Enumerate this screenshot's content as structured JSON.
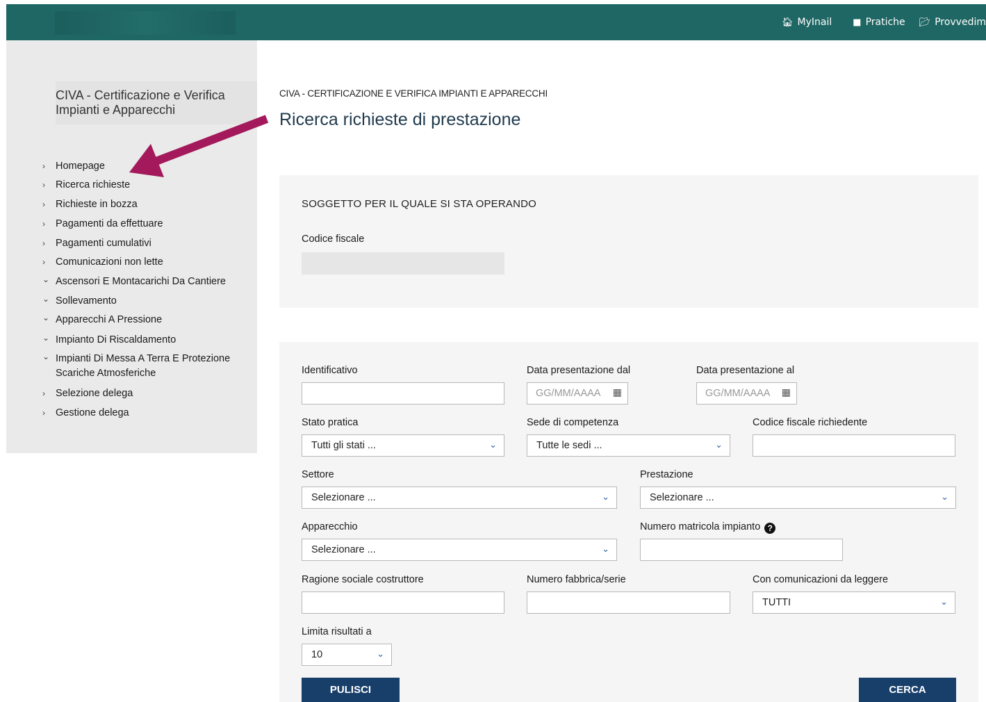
{
  "topbar": {
    "nav": [
      {
        "label": "MyInail",
        "icon": "home-icon"
      },
      {
        "label": "Pratiche",
        "icon": "document-icon"
      },
      {
        "label": "Provvedim",
        "icon": "folder-open-icon"
      }
    ]
  },
  "sidebar": {
    "title": "CIVA - Certificazione e Verifica Impianti e Apparecchi",
    "items": [
      {
        "label": "Homepage",
        "expanded": false
      },
      {
        "label": "Ricerca richieste",
        "expanded": false
      },
      {
        "label": "Richieste in bozza",
        "expanded": false
      },
      {
        "label": "Pagamenti da effettuare",
        "expanded": false
      },
      {
        "label": "Pagamenti cumulativi",
        "expanded": false
      },
      {
        "label": "Comunicazioni non lette",
        "expanded": false
      },
      {
        "label": "Ascensori E Montacarichi Da Cantiere",
        "expanded": true
      },
      {
        "label": "Sollevamento",
        "expanded": true
      },
      {
        "label": "Apparecchi A Pressione",
        "expanded": true
      },
      {
        "label": "Impianto Di Riscaldamento",
        "expanded": true
      },
      {
        "label": "Impianti Di Messa A Terra E Protezione Scariche Atmosferiche",
        "expanded": true
      },
      {
        "label": "Selezione delega",
        "expanded": false
      },
      {
        "label": "Gestione delega",
        "expanded": false
      }
    ]
  },
  "main": {
    "breadcrumb": "CIVA - CERTIFICAZIONE E VERIFICA IMPIANTI E APPARECCHI",
    "title": "Ricerca richieste di prestazione"
  },
  "soggetto": {
    "heading": "SOGGETTO PER IL QUALE SI STA OPERANDO",
    "codice_fiscale_label": "Codice fiscale",
    "codice_fiscale_value": ""
  },
  "form": {
    "identificativo": {
      "label": "Identificativo",
      "value": ""
    },
    "data_dal": {
      "label": "Data presentazione dal",
      "placeholder": "GG/MM/AAAA"
    },
    "data_al": {
      "label": "Data presentazione al",
      "placeholder": "GG/MM/AAAA"
    },
    "stato_pratica": {
      "label": "Stato pratica",
      "value": "Tutti gli stati ..."
    },
    "sede": {
      "label": "Sede di competenza",
      "value": "Tutte le sedi ..."
    },
    "cf_richiedente": {
      "label": "Codice fiscale richiedente",
      "value": ""
    },
    "settore": {
      "label": "Settore",
      "value": "Selezionare ..."
    },
    "prestazione": {
      "label": "Prestazione",
      "value": "Selezionare ..."
    },
    "apparecchio": {
      "label": "Apparecchio",
      "value": "Selezionare ..."
    },
    "matricola": {
      "label": "Numero matricola impianto",
      "value": ""
    },
    "ragione_sociale": {
      "label": "Ragione sociale costruttore",
      "value": ""
    },
    "numero_fabbrica": {
      "label": "Numero fabbrica/serie",
      "value": ""
    },
    "comunicazioni": {
      "label": "Con comunicazioni da leggere",
      "value": "TUTTI"
    },
    "limita": {
      "label": "Limita risultati a",
      "value": "10"
    }
  },
  "buttons": {
    "pulisci": "PULISCI",
    "cerca": "CERCA"
  },
  "colors": {
    "topbar": "#1f6764",
    "button": "#173f6a",
    "annotation_arrow": "#a3195b"
  }
}
